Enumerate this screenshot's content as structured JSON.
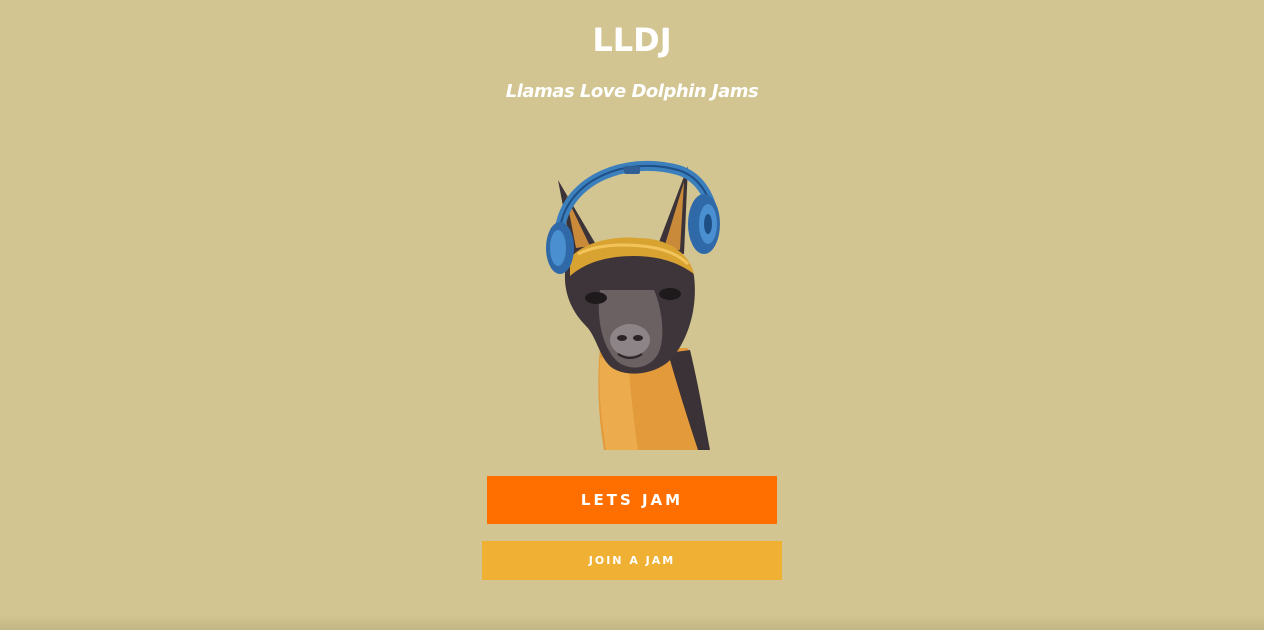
{
  "header": {
    "title": "LLDJ",
    "subtitle": "Llamas Love Dolphin Jams"
  },
  "hero": {
    "image_name": "llama-with-headphones"
  },
  "actions": {
    "primary_label": "LETS JAM",
    "secondary_label": "JOIN A JAM"
  },
  "colors": {
    "background": "#d2c591",
    "primary_button": "#ff6f00",
    "secondary_button": "#f0b033",
    "text": "#ffffff"
  }
}
